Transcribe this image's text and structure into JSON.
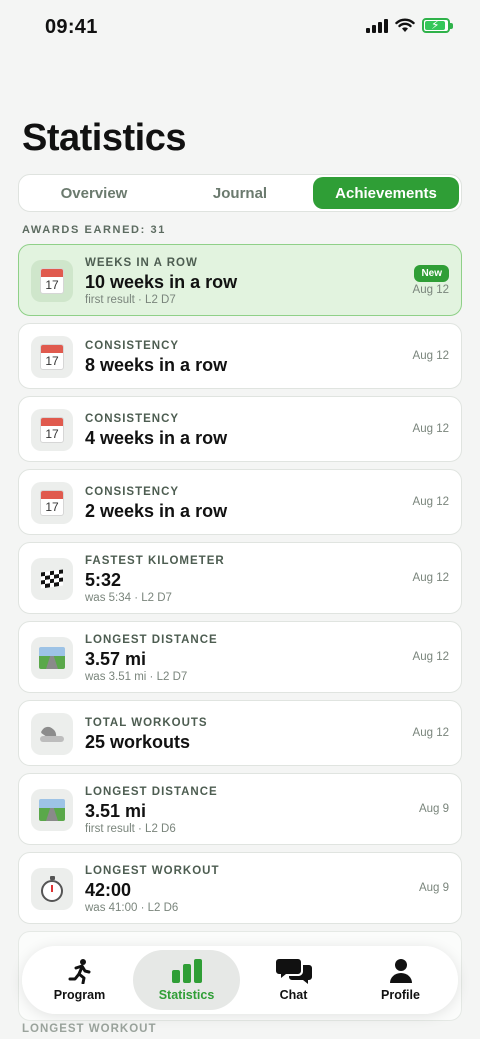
{
  "status_bar": {
    "time": "09:41"
  },
  "header": {
    "title": "Statistics"
  },
  "segments": [
    {
      "label": "Overview"
    },
    {
      "label": "Journal"
    },
    {
      "label": "Achievements"
    }
  ],
  "awards": {
    "label": "AWARDS EARNED: 31"
  },
  "achievements": [
    {
      "icon": "calendar-icon",
      "category": "WEEKS IN A ROW",
      "value": "10 weeks in a row",
      "sub": "first result · L2 D7",
      "date": "Aug 12",
      "badge": "New"
    },
    {
      "icon": "calendar-icon",
      "category": "CONSISTENCY",
      "value": "8 weeks in a row",
      "date": "Aug 12"
    },
    {
      "icon": "calendar-icon",
      "category": "CONSISTENCY",
      "value": "4 weeks in a row",
      "date": "Aug 12"
    },
    {
      "icon": "calendar-icon",
      "category": "CONSISTENCY",
      "value": "2 weeks in a row",
      "date": "Aug 12"
    },
    {
      "icon": "checkered-flag-icon",
      "category": "FASTEST KILOMETER",
      "value": "5:32",
      "sub": "was 5:34 · L2 D7",
      "date": "Aug 12"
    },
    {
      "icon": "road-icon",
      "category": "LONGEST DISTANCE",
      "value": "3.57 mi",
      "sub": "was 3.51 mi · L2 D7",
      "date": "Aug 12"
    },
    {
      "icon": "shoe-icon",
      "category": "TOTAL WORKOUTS",
      "value": "25 workouts",
      "date": "Aug 12"
    },
    {
      "icon": "road-icon",
      "category": "LONGEST DISTANCE",
      "value": "3.51 mi",
      "sub": "first result · L2 D6",
      "date": "Aug 9"
    },
    {
      "icon": "stopwatch-icon",
      "category": "LONGEST WORKOUT",
      "value": "42:00",
      "sub": "was 41:00 · L2 D6",
      "date": "Aug 9"
    }
  ],
  "peek_label": "LONGEST WORKOUT",
  "tabbar": [
    {
      "label": "Program",
      "icon": "running-person-icon"
    },
    {
      "label": "Statistics",
      "icon": "bar-chart-icon"
    },
    {
      "label": "Chat",
      "icon": "chat-bubbles-icon"
    },
    {
      "label": "Profile",
      "icon": "person-icon"
    }
  ],
  "colors": {
    "accent": "#2f9e36",
    "highlight_bg": "#e2f3df",
    "badge": "#2f9e36"
  }
}
